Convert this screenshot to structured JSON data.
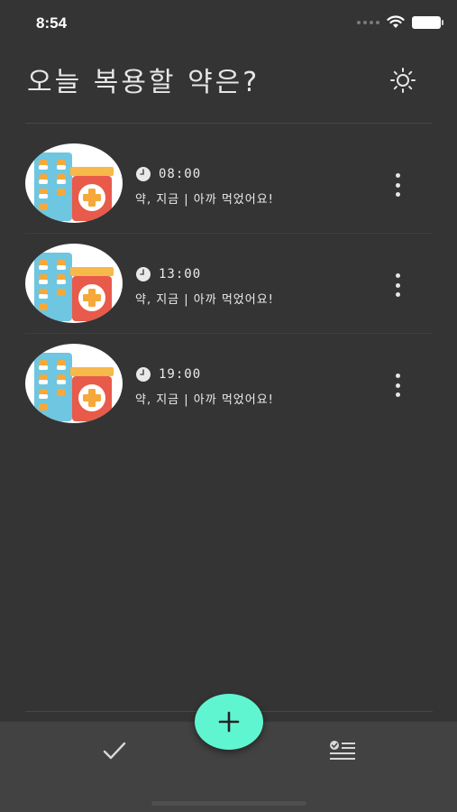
{
  "status_bar": {
    "time": "8:54",
    "icons": [
      "signal-icon",
      "wifi-icon",
      "battery-icon"
    ]
  },
  "header": {
    "title": "오늘 복용할 약은?",
    "theme_icon": "sun-icon"
  },
  "medications": [
    {
      "time": "08:00",
      "description": "약, 지금 | 아까 먹었어요!",
      "icon": "medicine-icon"
    },
    {
      "time": "13:00",
      "description": "약, 지금 | 아까 먹었어요!",
      "icon": "medicine-icon"
    },
    {
      "time": "19:00",
      "description": "약, 지금 | 아까 먹었어요!",
      "icon": "medicine-icon"
    }
  ],
  "tab_bar": {
    "left_icon": "checkmark-icon",
    "right_icon": "checklist-icon",
    "fab_icon": "plus-icon"
  },
  "colors": {
    "background": "#343434",
    "tab_bar": "#424242",
    "fab": "#5ff5d1",
    "text": "#e8e8e8"
  }
}
